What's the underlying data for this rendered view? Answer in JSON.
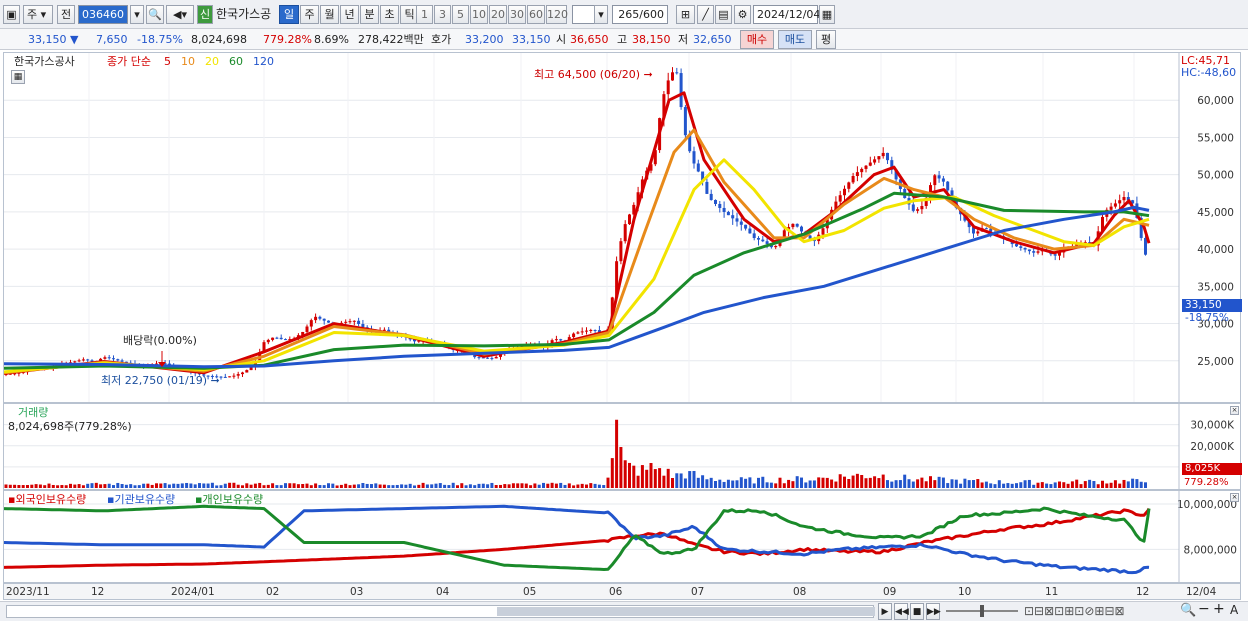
{
  "toolbar": {
    "market": "주",
    "prev": "전",
    "code": "036460",
    "name_badge": "신",
    "stock_name": "한국가스공",
    "periods": [
      "일",
      "주",
      "월",
      "년",
      "분",
      "초",
      "틱"
    ],
    "active_period": "일",
    "intervals": [
      "1",
      "3",
      "5",
      "10",
      "20",
      "30",
      "60",
      "120"
    ],
    "count": "265",
    "count_max": "/600",
    "date": "2024/12/04"
  },
  "quote": {
    "price": "33,150",
    "change": "7,650",
    "change_pct": "-18.75%",
    "volume": "8,024,698",
    "volume_ratio": "779.28%",
    "turnover": "8.69%",
    "amount": "278,422백만",
    "hoga_label": "호가",
    "bid": "33,200",
    "ask": "33,150",
    "open_label": "시",
    "open": "36,650",
    "high_label": "고",
    "high": "38,150",
    "low_label": "저",
    "low": "32,650",
    "buy": "매수",
    "sell": "매도",
    "avg": "평"
  },
  "price_pane": {
    "legend_name": "한국가스공사",
    "legend_type": "종가 단순",
    "ma": [
      "5",
      "10",
      "20",
      "60",
      "120"
    ],
    "ma_colors": [
      "#d40000",
      "#e88a1a",
      "#f2e400",
      "#1a8a2a",
      "#2255cc"
    ],
    "lc": "LC:45,71",
    "hc": "HC:-48,60",
    "high_note": "최고 64,500 (06/20)",
    "low_note": "최저 22,750 (01/19)",
    "div_note": "배당락(0.00%)",
    "last_price": "33,150",
    "last_pct": "-18.75%",
    "ticks": [
      "60,000",
      "55,000",
      "50,000",
      "45,000",
      "40,000",
      "35,000",
      "30,000",
      "25,000"
    ]
  },
  "volume_pane": {
    "title": "거래량",
    "value": "8,024,698주(779.28%)",
    "ticks": [
      "30,000K",
      "20,000K",
      "10,000K"
    ],
    "last": "8,025K",
    "last_pct": "779.28%"
  },
  "hold_pane": {
    "titles": [
      "외국인보유수량",
      "기관보유수량",
      "개인보유수량"
    ],
    "colors": [
      "#d40000",
      "#2255cc",
      "#1a8a2a"
    ],
    "ticks": [
      "10,000,000",
      "8,000,000"
    ]
  },
  "x_axis": [
    "2023/11",
    "12",
    "2024/01",
    "02",
    "03",
    "04",
    "05",
    "06",
    "07",
    "08",
    "09",
    "10",
    "11",
    "12",
    "12/04"
  ],
  "chart_data": {
    "type": "candlestick",
    "series_name": "한국가스공사",
    "y_range": [
      20000,
      65000
    ],
    "close_path": [
      [
        0,
        23200
      ],
      [
        10,
        23300
      ],
      [
        20,
        23500
      ],
      [
        30,
        23800
      ],
      [
        40,
        24000
      ],
      [
        50,
        24200
      ],
      [
        60,
        24600
      ],
      [
        70,
        24900
      ],
      [
        80,
        25200
      ],
      [
        90,
        24800
      ],
      [
        100,
        25500
      ],
      [
        110,
        25200
      ],
      [
        120,
        24800
      ],
      [
        130,
        24500
      ],
      [
        140,
        24300
      ],
      [
        150,
        24600
      ],
      [
        160,
        24700
      ],
      [
        170,
        24000
      ],
      [
        180,
        23800
      ],
      [
        190,
        23400
      ],
      [
        200,
        23000
      ],
      [
        210,
        22900
      ],
      [
        220,
        22800
      ],
      [
        230,
        23000
      ],
      [
        240,
        23500
      ],
      [
        250,
        24400
      ],
      [
        260,
        27500
      ],
      [
        270,
        28200
      ],
      [
        280,
        27800
      ],
      [
        290,
        28000
      ],
      [
        300,
        29000
      ],
      [
        310,
        31000
      ],
      [
        320,
        30400
      ],
      [
        330,
        29800
      ],
      [
        340,
        30200
      ],
      [
        350,
        30400
      ],
      [
        360,
        29400
      ],
      [
        370,
        28800
      ],
      [
        380,
        29200
      ],
      [
        390,
        28400
      ],
      [
        400,
        28300
      ],
      [
        410,
        27600
      ],
      [
        420,
        27800
      ],
      [
        430,
        27300
      ],
      [
        440,
        27100
      ],
      [
        450,
        26400
      ],
      [
        460,
        26600
      ],
      [
        470,
        25500
      ],
      [
        480,
        25400
      ],
      [
        490,
        25300
      ],
      [
        500,
        26300
      ],
      [
        510,
        26700
      ],
      [
        520,
        27000
      ],
      [
        530,
        27300
      ],
      [
        540,
        26800
      ],
      [
        550,
        28000
      ],
      [
        560,
        27600
      ],
      [
        570,
        28700
      ],
      [
        580,
        29000
      ],
      [
        590,
        29200
      ],
      [
        600,
        28500
      ],
      [
        605,
        29500
      ],
      [
        612,
        38000
      ],
      [
        620,
        43000
      ],
      [
        630,
        46000
      ],
      [
        640,
        50000
      ],
      [
        650,
        52000
      ],
      [
        658,
        60000
      ],
      [
        665,
        63000
      ],
      [
        672,
        64500
      ],
      [
        680,
        56000
      ],
      [
        688,
        52000
      ],
      [
        696,
        50000
      ],
      [
        704,
        47000
      ],
      [
        712,
        46000
      ],
      [
        720,
        45000
      ],
      [
        730,
        44000
      ],
      [
        740,
        43000
      ],
      [
        750,
        41500
      ],
      [
        760,
        41000
      ],
      [
        770,
        40000
      ],
      [
        780,
        42500
      ],
      [
        790,
        43500
      ],
      [
        800,
        42000
      ],
      [
        810,
        41000
      ],
      [
        820,
        43000
      ],
      [
        830,
        46000
      ],
      [
        840,
        48000
      ],
      [
        850,
        50000
      ],
      [
        860,
        51000
      ],
      [
        870,
        52000
      ],
      [
        880,
        53000
      ],
      [
        890,
        50000
      ],
      [
        900,
        47000
      ],
      [
        910,
        45000
      ],
      [
        920,
        46000
      ],
      [
        930,
        50000
      ],
      [
        940,
        49000
      ],
      [
        950,
        46000
      ],
      [
        960,
        44000
      ],
      [
        970,
        42000
      ],
      [
        980,
        43000
      ],
      [
        990,
        42000
      ],
      [
        1000,
        41500
      ],
      [
        1010,
        40500
      ],
      [
        1020,
        40000
      ],
      [
        1030,
        39500
      ],
      [
        1040,
        40000
      ],
      [
        1050,
        39000
      ],
      [
        1060,
        40000
      ],
      [
        1070,
        40500
      ],
      [
        1080,
        41000
      ],
      [
        1090,
        40500
      ],
      [
        1100,
        45000
      ],
      [
        1110,
        46000
      ],
      [
        1120,
        47000
      ],
      [
        1130,
        46000
      ],
      [
        1138,
        41000
      ],
      [
        1142,
        39000
      ],
      [
        1145,
        33150
      ]
    ],
    "ma_paths": {
      "5": [
        [
          0,
          23300
        ],
        [
          100,
          24900
        ],
        [
          200,
          23400
        ],
        [
          260,
          26200
        ],
        [
          330,
          30000
        ],
        [
          400,
          28400
        ],
        [
          480,
          25600
        ],
        [
          560,
          27500
        ],
        [
          605,
          29000
        ],
        [
          630,
          44000
        ],
        [
          665,
          60000
        ],
        [
          680,
          61000
        ],
        [
          700,
          52000
        ],
        [
          740,
          44000
        ],
        [
          770,
          41000
        ],
        [
          800,
          42000
        ],
        [
          830,
          45000
        ],
        [
          870,
          50000
        ],
        [
          890,
          51000
        ],
        [
          910,
          47000
        ],
        [
          940,
          48000
        ],
        [
          970,
          43000
        ],
        [
          1010,
          41000
        ],
        [
          1050,
          39500
        ],
        [
          1090,
          40800
        ],
        [
          1110,
          44500
        ],
        [
          1125,
          46500
        ],
        [
          1140,
          43000
        ],
        [
          1145,
          40800
        ]
      ],
      "10": [
        [
          0,
          23400
        ],
        [
          100,
          24800
        ],
        [
          200,
          23600
        ],
        [
          260,
          25600
        ],
        [
          330,
          29600
        ],
        [
          400,
          28500
        ],
        [
          480,
          25900
        ],
        [
          560,
          27300
        ],
        [
          605,
          28800
        ],
        [
          640,
          42000
        ],
        [
          670,
          53000
        ],
        [
          690,
          56000
        ],
        [
          720,
          49000
        ],
        [
          770,
          41500
        ],
        [
          800,
          41500
        ],
        [
          840,
          46000
        ],
        [
          880,
          49500
        ],
        [
          910,
          48000
        ],
        [
          940,
          47000
        ],
        [
          970,
          44000
        ],
        [
          1010,
          41500
        ],
        [
          1050,
          40000
        ],
        [
          1090,
          40500
        ],
        [
          1120,
          44000
        ],
        [
          1145,
          43200
        ]
      ],
      "20": [
        [
          0,
          23500
        ],
        [
          100,
          24700
        ],
        [
          200,
          23800
        ],
        [
          260,
          25000
        ],
        [
          330,
          28800
        ],
        [
          400,
          28400
        ],
        [
          480,
          26300
        ],
        [
          560,
          27100
        ],
        [
          605,
          28400
        ],
        [
          650,
          36000
        ],
        [
          690,
          48000
        ],
        [
          720,
          52000
        ],
        [
          750,
          48000
        ],
        [
          780,
          43000
        ],
        [
          800,
          41000
        ],
        [
          840,
          42500
        ],
        [
          880,
          45500
        ],
        [
          910,
          46500
        ],
        [
          950,
          47000
        ],
        [
          990,
          44500
        ],
        [
          1030,
          42500
        ],
        [
          1060,
          41000
        ],
        [
          1090,
          40500
        ],
        [
          1120,
          43000
        ],
        [
          1145,
          44000
        ]
      ],
      "60": [
        [
          0,
          24000
        ],
        [
          100,
          24300
        ],
        [
          200,
          24000
        ],
        [
          260,
          24400
        ],
        [
          330,
          26500
        ],
        [
          400,
          27100
        ],
        [
          480,
          27000
        ],
        [
          560,
          27200
        ],
        [
          605,
          27800
        ],
        [
          650,
          31500
        ],
        [
          690,
          36500
        ],
        [
          740,
          39500
        ],
        [
          800,
          42000
        ],
        [
          860,
          45500
        ],
        [
          890,
          47500
        ],
        [
          940,
          47000
        ],
        [
          1000,
          45200
        ],
        [
          1080,
          45000
        ],
        [
          1120,
          45000
        ],
        [
          1145,
          44500
        ]
      ],
      "120": [
        [
          0,
          24600
        ],
        [
          100,
          24500
        ],
        [
          200,
          24200
        ],
        [
          260,
          24300
        ],
        [
          330,
          25000
        ],
        [
          400,
          25600
        ],
        [
          480,
          26000
        ],
        [
          560,
          26400
        ],
        [
          605,
          26800
        ],
        [
          660,
          29500
        ],
        [
          700,
          31500
        ],
        [
          760,
          33500
        ],
        [
          820,
          35000
        ],
        [
          880,
          37500
        ],
        [
          940,
          40000
        ],
        [
          1000,
          42500
        ],
        [
          1060,
          44000
        ],
        [
          1110,
          45000
        ],
        [
          1130,
          45600
        ],
        [
          1145,
          45200
        ]
      ]
    },
    "volume_path": [
      [
        608,
        18000
      ],
      [
        612,
        34000
      ],
      [
        616,
        20000
      ],
      [
        620,
        12000
      ],
      [
        630,
        10000
      ],
      [
        640,
        9000
      ],
      [
        650,
        11000
      ],
      [
        660,
        9000
      ],
      [
        670,
        6000
      ],
      [
        680,
        8000
      ],
      [
        700,
        5000
      ],
      [
        740,
        4000
      ],
      [
        800,
        4500
      ],
      [
        840,
        6000
      ],
      [
        870,
        7000
      ],
      [
        900,
        5000
      ],
      [
        940,
        4000
      ],
      [
        1000,
        3000
      ],
      [
        1060,
        3000
      ],
      [
        1100,
        3500
      ],
      [
        1140,
        3500
      ],
      [
        1145,
        8025
      ]
    ],
    "holdings": {
      "외국인보유수량": [
        [
          0,
          7200000
        ],
        [
          100,
          7300000
        ],
        [
          200,
          7350000
        ],
        [
          260,
          7450000
        ],
        [
          400,
          7700000
        ],
        [
          500,
          8000000
        ],
        [
          605,
          8400000
        ],
        [
          630,
          8600000
        ],
        [
          660,
          8700000
        ],
        [
          690,
          8200000
        ],
        [
          720,
          7900000
        ],
        [
          760,
          7800000
        ],
        [
          800,
          8000000
        ],
        [
          840,
          7900000
        ],
        [
          880,
          7900000
        ],
        [
          920,
          8300000
        ],
        [
          960,
          8600000
        ],
        [
          1000,
          8900000
        ],
        [
          1040,
          9100000
        ],
        [
          1080,
          9400000
        ],
        [
          1120,
          9700000
        ],
        [
          1140,
          9500000
        ],
        [
          1145,
          9800000
        ]
      ],
      "기관보유수량": [
        [
          0,
          8300000
        ],
        [
          100,
          8200000
        ],
        [
          200,
          8200000
        ],
        [
          260,
          8100000
        ],
        [
          300,
          9700000
        ],
        [
          400,
          9800000
        ],
        [
          500,
          9900000
        ],
        [
          605,
          9600000
        ],
        [
          630,
          8500000
        ],
        [
          660,
          8600000
        ],
        [
          690,
          9000000
        ],
        [
          720,
          8000000
        ],
        [
          760,
          7900000
        ],
        [
          800,
          7800000
        ],
        [
          840,
          8000000
        ],
        [
          880,
          8100000
        ],
        [
          920,
          8200000
        ],
        [
          960,
          7800000
        ],
        [
          1000,
          7500000
        ],
        [
          1060,
          7200000
        ],
        [
          1100,
          7100000
        ],
        [
          1130,
          7000000
        ],
        [
          1145,
          7200000
        ]
      ],
      "개인보유수량": [
        [
          0,
          9800000
        ],
        [
          100,
          9700000
        ],
        [
          200,
          9900000
        ],
        [
          260,
          9800000
        ],
        [
          300,
          8300000
        ],
        [
          400,
          8300000
        ],
        [
          500,
          7300000
        ],
        [
          605,
          7100000
        ],
        [
          630,
          8600000
        ],
        [
          660,
          7800000
        ],
        [
          690,
          8000000
        ],
        [
          720,
          9700000
        ],
        [
          760,
          9700000
        ],
        [
          800,
          9000000
        ],
        [
          840,
          8700000
        ],
        [
          880,
          8500000
        ],
        [
          920,
          8600000
        ],
        [
          960,
          9500000
        ],
        [
          1000,
          9600000
        ],
        [
          1040,
          9800000
        ],
        [
          1080,
          9500000
        ],
        [
          1120,
          9300000
        ],
        [
          1140,
          8300000
        ],
        [
          1145,
          9800000
        ]
      ]
    }
  }
}
